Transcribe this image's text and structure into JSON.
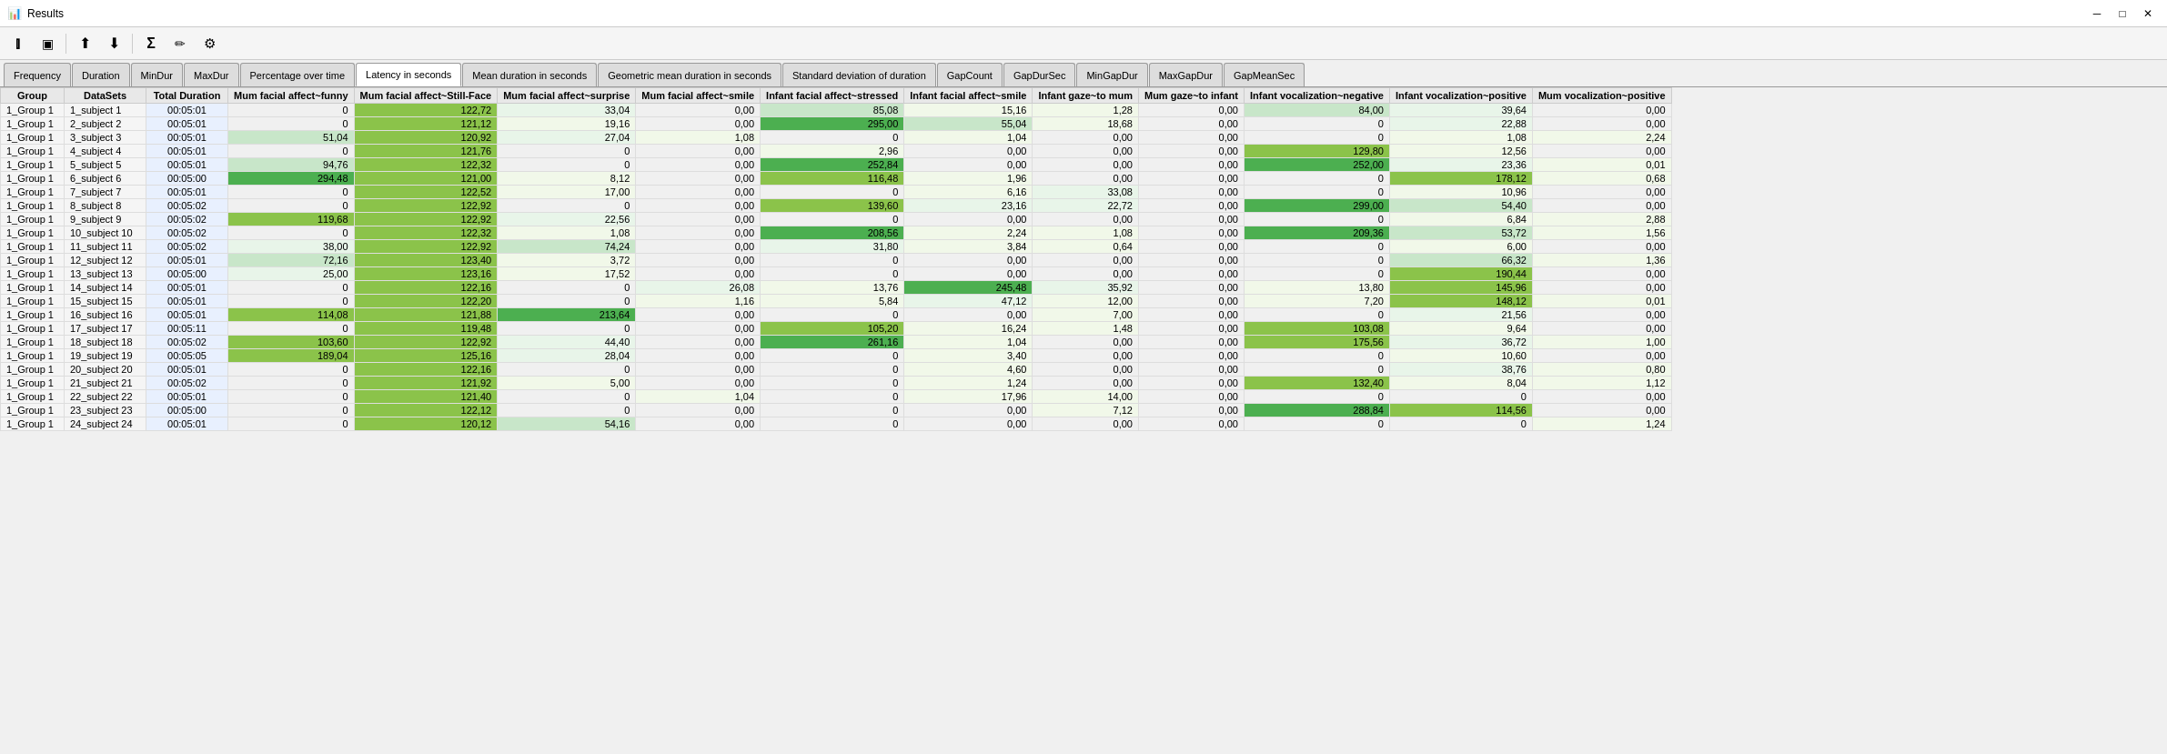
{
  "titleBar": {
    "icon": "📊",
    "title": "Results",
    "minimizeLabel": "─",
    "maximizeLabel": "□",
    "closeLabel": "✕"
  },
  "toolbar": {
    "buttons": [
      {
        "name": "columns-icon",
        "symbol": "⫿",
        "label": "Columns"
      },
      {
        "name": "select-icon",
        "symbol": "▣",
        "label": "Select"
      },
      {
        "name": "import-icon",
        "symbol": "⬆",
        "label": "Import"
      },
      {
        "name": "export-icon",
        "symbol": "⬇",
        "label": "Export CSV"
      },
      {
        "name": "sum-icon",
        "symbol": "Σ",
        "label": "Sum"
      },
      {
        "name": "edit-icon",
        "symbol": "✏",
        "label": "Edit"
      },
      {
        "name": "settings-icon",
        "symbol": "⚙",
        "label": "Settings"
      }
    ]
  },
  "tabs": [
    {
      "id": "frequency",
      "label": "Frequency"
    },
    {
      "id": "duration",
      "label": "Duration"
    },
    {
      "id": "minDur",
      "label": "MinDur"
    },
    {
      "id": "maxDur",
      "label": "MaxDur"
    },
    {
      "id": "percentageOverTime",
      "label": "Percentage over time"
    },
    {
      "id": "latencyInSeconds",
      "label": "Latency in seconds",
      "active": true
    },
    {
      "id": "meanDuration",
      "label": "Mean duration in seconds"
    },
    {
      "id": "geometricMean",
      "label": "Geometric mean duration in seconds"
    },
    {
      "id": "stdDev",
      "label": "Standard deviation of duration"
    },
    {
      "id": "gapCount",
      "label": "GapCount"
    },
    {
      "id": "gapDurSec",
      "label": "GapDurSec"
    },
    {
      "id": "minGapDur",
      "label": "MinGapDur"
    },
    {
      "id": "maxGapDur",
      "label": "MaxGapDur"
    },
    {
      "id": "gapMeanSec",
      "label": "GapMeanSec"
    }
  ],
  "columns": [
    "Group",
    "DataSets",
    "Total Duration",
    "Mum facial affect~funny",
    "Mum facial affect~Still-Face",
    "Mum facial affect~surprise",
    "Mum facial affect~smile",
    "Infant facial affect~stressed",
    "Infant facial affect~smile",
    "Infant gaze~to mum",
    "Mum gaze~to infant",
    "Infant vocalization~negative",
    "Infant vocalization~positive",
    "Mum vocalization~positive"
  ],
  "rows": [
    {
      "group": "1_Group 1",
      "dataset": "1_subject 1",
      "totalDur": "00:05:01",
      "cols": [
        "0",
        "122,72",
        "33,04",
        "0,00",
        "85,08",
        "15,16",
        "1,28",
        "0,00",
        "84,00",
        "39,64",
        "0,00"
      ],
      "highlights": [
        false,
        true,
        false,
        false,
        false,
        false,
        false,
        false,
        false,
        false,
        false
      ]
    },
    {
      "group": "1_Group 1",
      "dataset": "2_subject 2",
      "totalDur": "00:05:01",
      "cols": [
        "0",
        "121,12",
        "19,16",
        "0,00",
        "295,00",
        "55,04",
        "18,68",
        "0,00",
        "0",
        "22,88",
        "0,00"
      ],
      "highlights": [
        false,
        false,
        false,
        false,
        true,
        false,
        true,
        false,
        false,
        false,
        false
      ]
    },
    {
      "group": "1_Group 1",
      "dataset": "3_subject 3",
      "totalDur": "00:05:01",
      "cols": [
        "51,04",
        "120,92",
        "27,04",
        "1,08",
        "0",
        "1,04",
        "0,00",
        "0,00",
        "0",
        "1,08",
        "2,24"
      ],
      "highlights": [
        false,
        false,
        false,
        false,
        false,
        false,
        false,
        false,
        false,
        false,
        true
      ]
    },
    {
      "group": "1_Group 1",
      "dataset": "4_subject 4",
      "totalDur": "00:05:01",
      "cols": [
        "0",
        "121,76",
        "0",
        "0,00",
        "2,96",
        "0,00",
        "0,00",
        "0,00",
        "129,80",
        "12,56",
        "0,00"
      ],
      "highlights": [
        false,
        true,
        false,
        false,
        false,
        false,
        false,
        false,
        false,
        false,
        false
      ]
    },
    {
      "group": "1_Group 1",
      "dataset": "5_subject 5",
      "totalDur": "00:05:01",
      "cols": [
        "94,76",
        "122,32",
        "0",
        "0,00",
        "252,84",
        "0,00",
        "0,00",
        "0,00",
        "252,00",
        "23,36",
        "0,01"
      ],
      "highlights": [
        false,
        false,
        false,
        false,
        true,
        false,
        false,
        false,
        true,
        false,
        false
      ]
    },
    {
      "group": "1_Group 1",
      "dataset": "6_subject 6",
      "totalDur": "00:05:00",
      "cols": [
        "294,48",
        "121,00",
        "8,12",
        "0,00",
        "116,48",
        "1,96",
        "0,00",
        "0,00",
        "0",
        "178,12",
        "0,68"
      ],
      "highlights": [
        true,
        false,
        false,
        false,
        false,
        false,
        false,
        false,
        false,
        true,
        false
      ]
    },
    {
      "group": "1_Group 1",
      "dataset": "7_subject 7",
      "totalDur": "00:05:01",
      "cols": [
        "0",
        "122,52",
        "17,00",
        "0,00",
        "0",
        "6,16",
        "33,08",
        "0,00",
        "0",
        "10,96",
        "0,00"
      ],
      "highlights": [
        false,
        false,
        false,
        false,
        false,
        false,
        true,
        false,
        false,
        false,
        false
      ]
    },
    {
      "group": "1_Group 1",
      "dataset": "8_subject 8",
      "totalDur": "00:05:02",
      "cols": [
        "0",
        "122,92",
        "0",
        "0,00",
        "139,60",
        "23,16",
        "22,72",
        "0,00",
        "299,00",
        "54,40",
        "0,00"
      ],
      "highlights": [
        false,
        false,
        false,
        false,
        false,
        false,
        false,
        false,
        true,
        false,
        false
      ]
    },
    {
      "group": "1_Group 1",
      "dataset": "9_subject 9",
      "totalDur": "00:05:02",
      "cols": [
        "119,68",
        "122,92",
        "22,56",
        "0,00",
        "0",
        "0,00",
        "0,00",
        "0,00",
        "0",
        "6,84",
        "2,88"
      ],
      "highlights": [
        false,
        false,
        false,
        false,
        false,
        false,
        false,
        false,
        false,
        false,
        false
      ]
    },
    {
      "group": "1_Group 1",
      "dataset": "10_subject 10",
      "totalDur": "00:05:02",
      "cols": [
        "0",
        "122,32",
        "1,08",
        "0,00",
        "208,56",
        "2,24",
        "1,08",
        "0,00",
        "209,36",
        "53,72",
        "1,56"
      ],
      "highlights": [
        false,
        false,
        false,
        false,
        true,
        false,
        false,
        false,
        true,
        false,
        true
      ]
    },
    {
      "group": "1_Group 1",
      "dataset": "11_subject 11",
      "totalDur": "00:05:02",
      "cols": [
        "38,00",
        "122,92",
        "74,24",
        "0,00",
        "31,80",
        "3,84",
        "0,64",
        "0,00",
        "0",
        "6,00",
        "0,00"
      ],
      "highlights": [
        false,
        false,
        false,
        false,
        false,
        false,
        false,
        false,
        false,
        false,
        false
      ]
    },
    {
      "group": "1_Group 1",
      "dataset": "12_subject 12",
      "totalDur": "00:05:01",
      "cols": [
        "72,16",
        "123,40",
        "3,72",
        "0,00",
        "0",
        "0,00",
        "0,00",
        "0,00",
        "0",
        "66,32",
        "1,36"
      ],
      "highlights": [
        false,
        true,
        false,
        false,
        false,
        false,
        false,
        false,
        false,
        false,
        false
      ]
    },
    {
      "group": "1_Group 1",
      "dataset": "13_subject 13",
      "totalDur": "00:05:00",
      "cols": [
        "25,00",
        "123,16",
        "17,52",
        "0,00",
        "0",
        "0,00",
        "0,00",
        "0,00",
        "0",
        "190,44",
        "0,00"
      ],
      "highlights": [
        false,
        false,
        false,
        false,
        false,
        false,
        false,
        false,
        false,
        true,
        false
      ]
    },
    {
      "group": "1_Group 1",
      "dataset": "14_subject 14",
      "totalDur": "00:05:01",
      "cols": [
        "0",
        "122,16",
        "0",
        "26,08",
        "13,76",
        "245,48",
        "35,92",
        "0,00",
        "13,80",
        "145,96",
        "0,00"
      ],
      "highlights": [
        false,
        false,
        false,
        true,
        false,
        true,
        false,
        false,
        false,
        false,
        false
      ]
    },
    {
      "group": "1_Group 1",
      "dataset": "15_subject 15",
      "totalDur": "00:05:01",
      "cols": [
        "0",
        "122,20",
        "0",
        "1,16",
        "5,84",
        "47,12",
        "12,00",
        "0,00",
        "7,20",
        "148,12",
        "0,01"
      ],
      "highlights": [
        false,
        false,
        false,
        false,
        false,
        false,
        false,
        false,
        false,
        false,
        false
      ]
    },
    {
      "group": "1_Group 1",
      "dataset": "16_subject 16",
      "totalDur": "00:05:01",
      "cols": [
        "114,08",
        "121,88",
        "213,64",
        "0,00",
        "0",
        "0,00",
        "7,00",
        "0,00",
        "0",
        "21,56",
        "0,00"
      ],
      "highlights": [
        false,
        false,
        true,
        false,
        false,
        false,
        false,
        false,
        false,
        false,
        false
      ]
    },
    {
      "group": "1_Group 1",
      "dataset": "17_subject 17",
      "totalDur": "00:05:11",
      "cols": [
        "0",
        "119,48",
        "0",
        "0,00",
        "105,20",
        "16,24",
        "1,48",
        "0,00",
        "103,08",
        "9,64",
        "0,00"
      ],
      "highlights": [
        false,
        false,
        false,
        false,
        false,
        false,
        false,
        false,
        false,
        false,
        false
      ]
    },
    {
      "group": "1_Group 1",
      "dataset": "18_subject 18",
      "totalDur": "00:05:02",
      "cols": [
        "103,60",
        "122,92",
        "44,40",
        "0,00",
        "261,16",
        "1,04",
        "0,00",
        "0,00",
        "175,56",
        "36,72",
        "1,00"
      ],
      "highlights": [
        false,
        false,
        false,
        false,
        true,
        false,
        false,
        false,
        true,
        false,
        false
      ]
    },
    {
      "group": "1_Group 1",
      "dataset": "19_subject 19",
      "totalDur": "00:05:05",
      "cols": [
        "189,04",
        "125,16",
        "28,04",
        "0,00",
        "0",
        "3,40",
        "0,00",
        "0,00",
        "0",
        "10,60",
        "0,00"
      ],
      "highlights": [
        false,
        true,
        false,
        false,
        false,
        false,
        false,
        false,
        false,
        false,
        false
      ]
    },
    {
      "group": "1_Group 1",
      "dataset": "20_subject 20",
      "totalDur": "00:05:01",
      "cols": [
        "0",
        "122,16",
        "0",
        "0,00",
        "0",
        "4,60",
        "0,00",
        "0,00",
        "0",
        "38,76",
        "0,80"
      ],
      "highlights": [
        false,
        false,
        false,
        false,
        false,
        false,
        false,
        false,
        false,
        false,
        false
      ]
    },
    {
      "group": "1_Group 1",
      "dataset": "21_subject 21",
      "totalDur": "00:05:02",
      "cols": [
        "0",
        "121,92",
        "5,00",
        "0,00",
        "0",
        "1,24",
        "0,00",
        "0,00",
        "132,40",
        "8,04",
        "1,12"
      ],
      "highlights": [
        false,
        false,
        false,
        false,
        false,
        false,
        false,
        false,
        false,
        false,
        false
      ]
    },
    {
      "group": "1_Group 1",
      "dataset": "22_subject 22",
      "totalDur": "00:05:01",
      "cols": [
        "0",
        "121,40",
        "0",
        "1,04",
        "0",
        "17,96",
        "14,00",
        "0,00",
        "0",
        "0",
        "0,00"
      ],
      "highlights": [
        false,
        false,
        false,
        false,
        false,
        false,
        false,
        false,
        false,
        false,
        false
      ]
    },
    {
      "group": "1_Group 1",
      "dataset": "23_subject 23",
      "totalDur": "00:05:00",
      "cols": [
        "0",
        "122,12",
        "0",
        "0,00",
        "0",
        "0,00",
        "7,12",
        "0,00",
        "288,84",
        "114,56",
        "0,00"
      ],
      "highlights": [
        false,
        false,
        false,
        false,
        false,
        false,
        false,
        false,
        true,
        false,
        false
      ]
    },
    {
      "group": "1_Group 1",
      "dataset": "24_subject 24",
      "totalDur": "00:05:01",
      "cols": [
        "0",
        "120,12",
        "54,16",
        "0,00",
        "0",
        "0,00",
        "0,00",
        "0,00",
        "0",
        "0",
        "1,24"
      ],
      "highlights": [
        false,
        false,
        false,
        false,
        false,
        false,
        false,
        false,
        false,
        false,
        false
      ]
    }
  ],
  "colors": {
    "greenDark": "#4caf50",
    "greenMed": "#8bc34a",
    "greenLight": "#c8e6c9",
    "yellowLight": "#fff9c4",
    "yellow": "#fff176",
    "blueLight": "#e3f2fd",
    "activeTab": "#ffffff",
    "inactiveTab": "#dddddd"
  }
}
